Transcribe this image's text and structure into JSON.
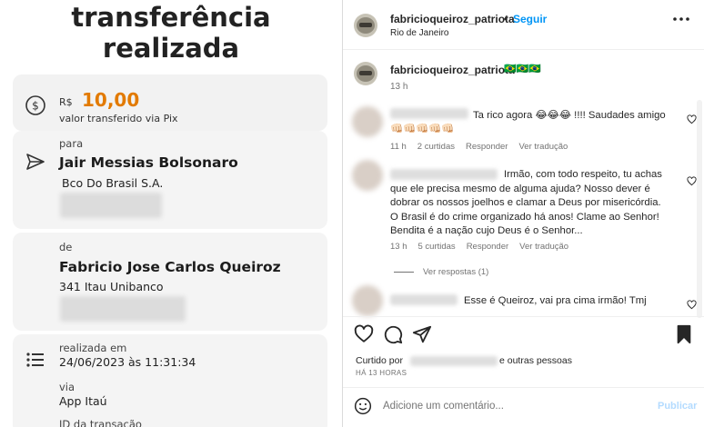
{
  "receipt": {
    "title_line1": "transferência",
    "title_line2": "realizada",
    "currency": "R$",
    "amount": "10,00",
    "amount_sublabel": "valor transferido via Pix",
    "to_label": "para",
    "to_name": "Jair Messias Bolsonaro",
    "to_bank": "Bco Do Brasil S.A.",
    "from_label": "de",
    "from_name": "Fabricio Jose Carlos Queiroz",
    "from_bank": "341 Itau Unibanco",
    "date_label": "realizada em",
    "date_value": "24/06/2023 às 11:31:34",
    "via_label": "via",
    "via_value": "App Itaú",
    "txid_label": "ID da transação",
    "amount_color": "#e27a00"
  },
  "post": {
    "username": "fabricioqueiroz_patriota",
    "dot": "•",
    "follow_label": "Seguir",
    "location": "Rio de Janeiro",
    "more_icon": "more-horizontal-icon",
    "follow_color": "#0095f6"
  },
  "caption": {
    "username": "fabricioqueiroz_patriota",
    "flags": "🇧🇷🇧🇷🇧🇷",
    "time": "13 h"
  },
  "comments": [
    {
      "text_line1": "Ta rico agora 😂😂😂 !!!! Saudades amigo",
      "text_line2": "👊🏻👊🏻👊🏻👊🏻👊🏻",
      "time": "11 h",
      "likes": "2 curtidas",
      "reply": "Responder",
      "translate": "Ver tradução"
    },
    {
      "text": "Irmão, com todo respeito, tu achas que ele precisa mesmo de alguma ajuda? Nosso dever é dobrar os nossos joelhos e clamar a Deus por misericórdia. O Brasil é do crime organizado há anos! Clame ao Senhor! Bendita é a nação cujo Deus é o Senhor...",
      "time": "13 h",
      "likes": "5 curtidas",
      "reply": "Responder",
      "translate": "Ver tradução",
      "view_replies": "Ver respostas (1)"
    },
    {
      "text": "Esse é Queiroz, vai pra cima irmão! Tmj"
    }
  ],
  "actions": {
    "like_icon": "heart-icon",
    "comment_icon": "comment-icon",
    "share_icon": "share-icon",
    "save_icon": "bookmark-icon",
    "liked_by_prefix": "Curtido por",
    "liked_by_suffix": "e outras pessoas",
    "time_ago": "HÁ 13 HORAS"
  },
  "composer": {
    "emoji_icon": "emoji-icon",
    "placeholder": "Adicione um comentário...",
    "publish_label": "Publicar"
  }
}
